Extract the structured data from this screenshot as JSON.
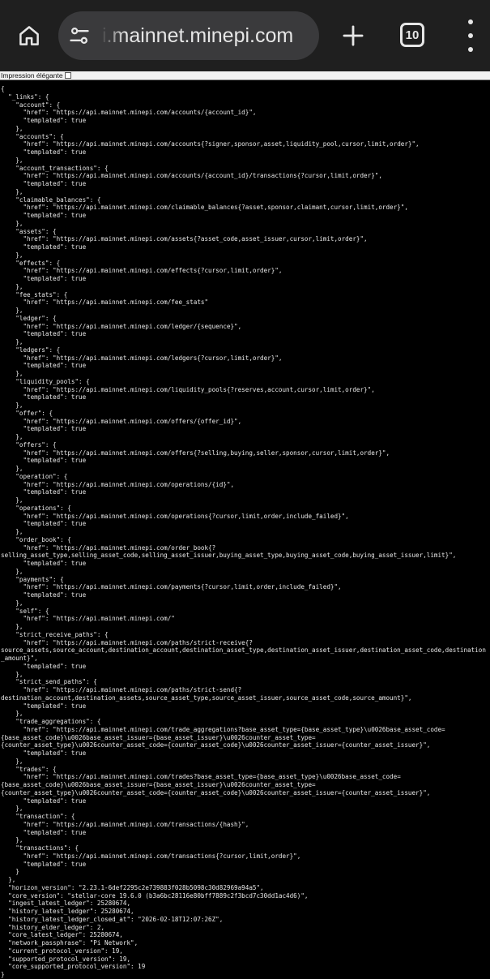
{
  "browser": {
    "url_display": "i.mainnet.minepi.com",
    "tab_count": "10",
    "icons": {
      "home": "home-icon",
      "site_info": "tune-icon",
      "new_tab": "plus-icon",
      "tabs": "tab-switcher-icon",
      "menu": "more-vert-icon"
    },
    "colors": {
      "toolbar": "#1f1f1f",
      "urlbar": "#3a3a3c",
      "page_background": "#000000",
      "text": "#e8e8e8"
    }
  },
  "viewer": {
    "pretty_print_label": "Impression élégante",
    "pretty_print_checked": false,
    "json_text": "{\n  \"_links\": {\n    \"account\": {\n      \"href\": \"https://api.mainnet.minepi.com/accounts/{account_id}\",\n      \"templated\": true\n    },\n    \"accounts\": {\n      \"href\": \"https://api.mainnet.minepi.com/accounts{?signer,sponsor,asset,liquidity_pool,cursor,limit,order}\",\n      \"templated\": true\n    },\n    \"account_transactions\": {\n      \"href\": \"https://api.mainnet.minepi.com/accounts/{account_id}/transactions{?cursor,limit,order}\",\n      \"templated\": true\n    },\n    \"claimable_balances\": {\n      \"href\": \"https://api.mainnet.minepi.com/claimable_balances{?asset,sponsor,claimant,cursor,limit,order}\",\n      \"templated\": true\n    },\n    \"assets\": {\n      \"href\": \"https://api.mainnet.minepi.com/assets{?asset_code,asset_issuer,cursor,limit,order}\",\n      \"templated\": true\n    },\n    \"effects\": {\n      \"href\": \"https://api.mainnet.minepi.com/effects{?cursor,limit,order}\",\n      \"templated\": true\n    },\n    \"fee_stats\": {\n      \"href\": \"https://api.mainnet.minepi.com/fee_stats\"\n    },\n    \"ledger\": {\n      \"href\": \"https://api.mainnet.minepi.com/ledger/{sequence}\",\n      \"templated\": true\n    },\n    \"ledgers\": {\n      \"href\": \"https://api.mainnet.minepi.com/ledgers{?cursor,limit,order}\",\n      \"templated\": true\n    },\n    \"liquidity_pools\": {\n      \"href\": \"https://api.mainnet.minepi.com/liquidity_pools{?reserves,account,cursor,limit,order}\",\n      \"templated\": true\n    },\n    \"offer\": {\n      \"href\": \"https://api.mainnet.minepi.com/offers/{offer_id}\",\n      \"templated\": true\n    },\n    \"offers\": {\n      \"href\": \"https://api.mainnet.minepi.com/offers{?selling,buying,seller,sponsor,cursor,limit,order}\",\n      \"templated\": true\n    },\n    \"operation\": {\n      \"href\": \"https://api.mainnet.minepi.com/operations/{id}\",\n      \"templated\": true\n    },\n    \"operations\": {\n      \"href\": \"https://api.mainnet.minepi.com/operations{?cursor,limit,order,include_failed}\",\n      \"templated\": true\n    },\n    \"order_book\": {\n      \"href\": \"https://api.mainnet.minepi.com/order_book{?\nselling_asset_type,selling_asset_code,selling_asset_issuer,buying_asset_type,buying_asset_code,buying_asset_issuer,limit}\",\n      \"templated\": true\n    },\n    \"payments\": {\n      \"href\": \"https://api.mainnet.minepi.com/payments{?cursor,limit,order,include_failed}\",\n      \"templated\": true\n    },\n    \"self\": {\n      \"href\": \"https://api.mainnet.minepi.com/\"\n    },\n    \"strict_receive_paths\": {\n      \"href\": \"https://api.mainnet.minepi.com/paths/strict-receive{?\nsource_assets,source_account,destination_account,destination_asset_type,destination_asset_issuer,destination_asset_code,destination_amount}\",\n      \"templated\": true\n    },\n    \"strict_send_paths\": {\n      \"href\": \"https://api.mainnet.minepi.com/paths/strict-send{?\ndestination_account,destination_assets,source_asset_type,source_asset_issuer,source_asset_code,source_amount}\",\n      \"templated\": true\n    },\n    \"trade_aggregations\": {\n      \"href\": \"https://api.mainnet.minepi.com/trade_aggregations?base_asset_type={base_asset_type}\\u0026base_asset_code=\n{base_asset_code}\\u0026base_asset_issuer={base_asset_issuer}\\u0026counter_asset_type=\n{counter_asset_type}\\u0026counter_asset_code={counter_asset_code}\\u0026counter_asset_issuer={counter_asset_issuer}\",\n      \"templated\": true\n    },\n    \"trades\": {\n      \"href\": \"https://api.mainnet.minepi.com/trades?base_asset_type={base_asset_type}\\u0026base_asset_code=\n{base_asset_code}\\u0026base_asset_issuer={base_asset_issuer}\\u0026counter_asset_type=\n{counter_asset_type}\\u0026counter_asset_code={counter_asset_code}\\u0026counter_asset_issuer={counter_asset_issuer}\",\n      \"templated\": true\n    },\n    \"transaction\": {\n      \"href\": \"https://api.mainnet.minepi.com/transactions/{hash}\",\n      \"templated\": true\n    },\n    \"transactions\": {\n      \"href\": \"https://api.mainnet.minepi.com/transactions{?cursor,limit,order}\",\n      \"templated\": true\n    }\n  },\n  \"horizon_version\": \"2.23.1-6def2295c2e739883f028b5098c30d82969a94a5\",\n  \"core_version\": \"stellar-core 19.6.0 (b3a6bc28116e80bff7889c2f3bcd7c30dd1ac4d6)\",\n  \"ingest_latest_ledger\": 25280674,\n  \"history_latest_ledger\": 25280674,\n  \"history_latest_ledger_closed_at\": \"2026-02-18T12:07:26Z\",\n  \"history_elder_ledger\": 2,\n  \"core_latest_ledger\": 25280674,\n  \"network_passphrase\": \"Pi Network\",\n  \"current_protocol_version\": 19,\n  \"supported_protocol_version\": 19,\n  \"core_supported_protocol_version\": 19\n}"
  }
}
